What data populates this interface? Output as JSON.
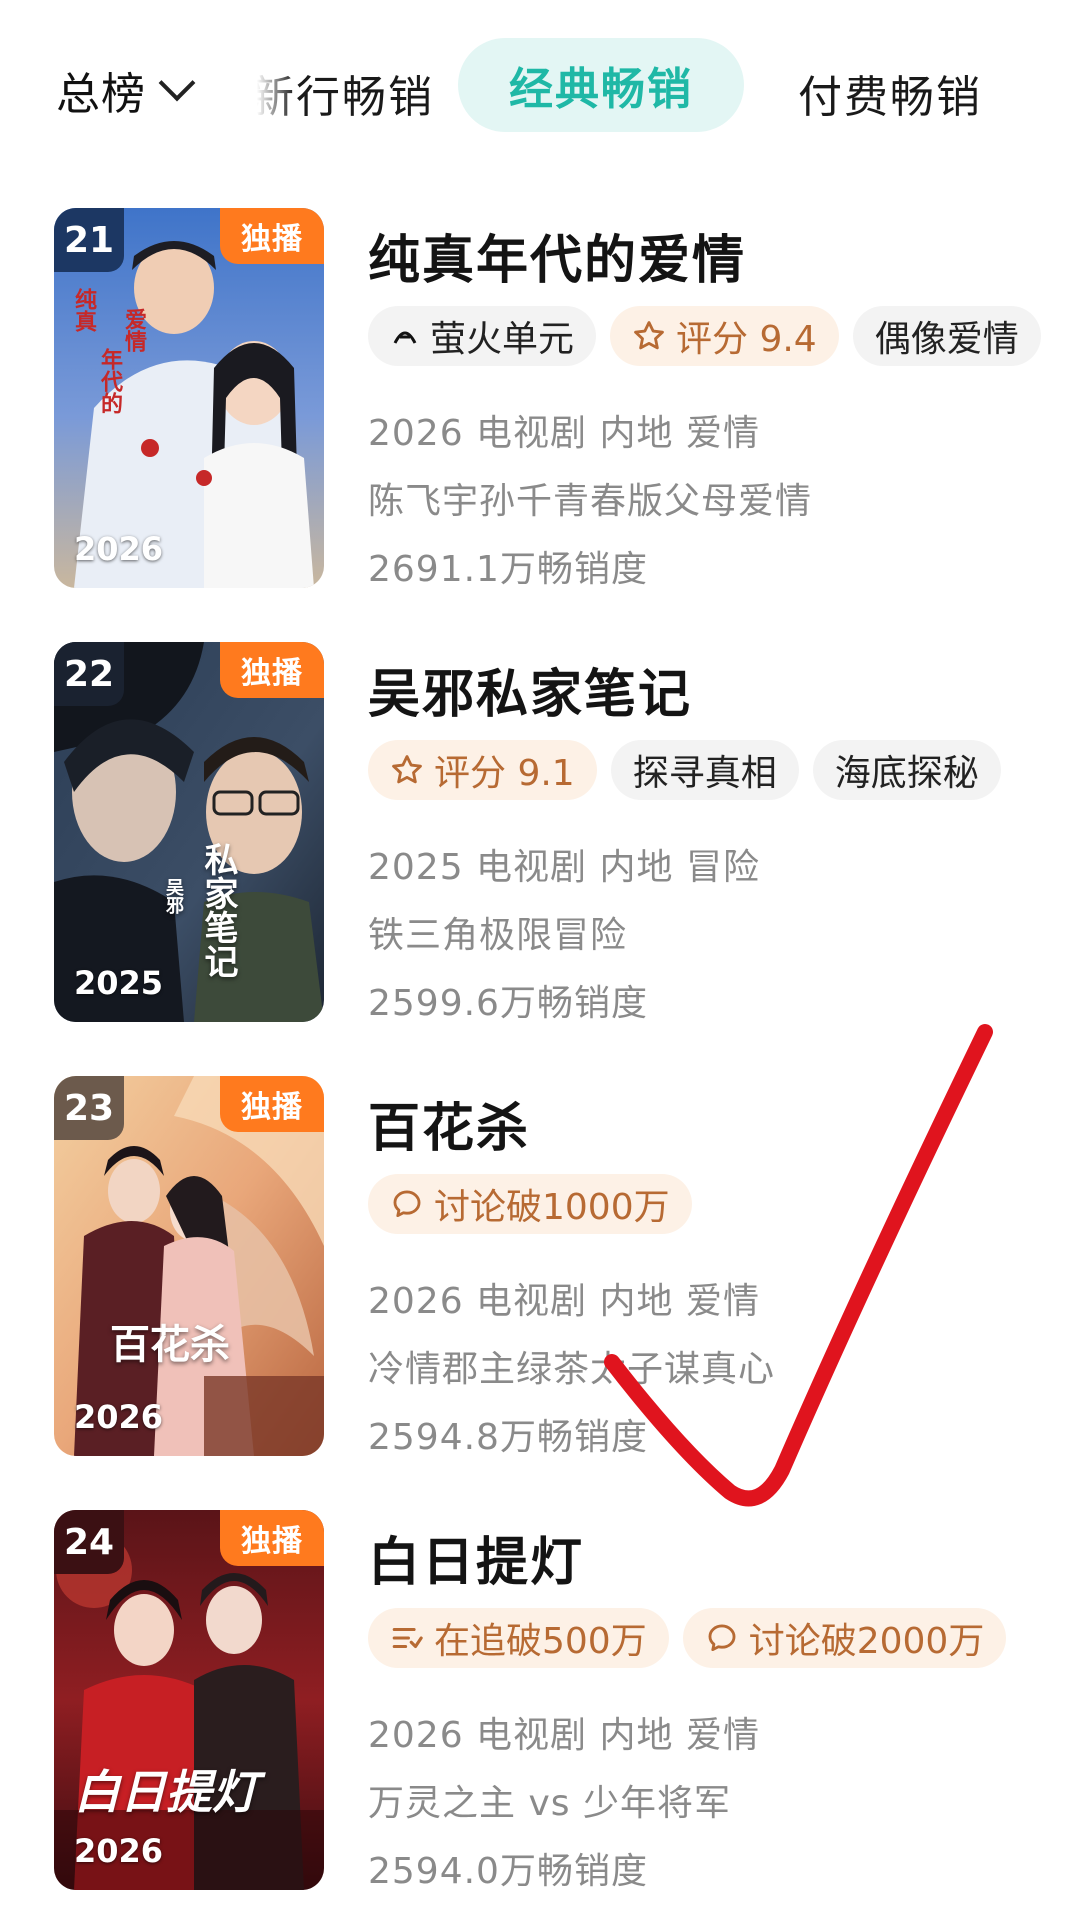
{
  "tabs": {
    "total": "总榜",
    "new": "新行畅销",
    "classic": "经典畅销",
    "paid": "付费畅销"
  },
  "badge_exclusive": "独播",
  "items": [
    {
      "rank": "21",
      "year": "2026",
      "title": "纯真年代的爱情",
      "tags": [
        {
          "text": "萤火单元",
          "icon": "firefly-logo-icon"
        },
        {
          "text": "评分 9.4",
          "icon": "star-icon"
        },
        {
          "text": "偶像爱情",
          "icon": ""
        }
      ],
      "meta": "2026 电视剧 内地 爱情",
      "desc": "陈飞宇孙千青春版父母爱情",
      "sales": "2691.1万畅销度"
    },
    {
      "rank": "22",
      "year": "2025",
      "title": "吴邪私家笔记",
      "tags": [
        {
          "text": "评分 9.1",
          "icon": "star-icon"
        },
        {
          "text": "探寻真相",
          "icon": ""
        },
        {
          "text": "海底探秘",
          "icon": ""
        }
      ],
      "meta": "2025 电视剧 内地 冒险",
      "desc": "铁三角极限冒险",
      "sales": "2599.6万畅销度"
    },
    {
      "rank": "23",
      "year": "2026",
      "title": "百花杀",
      "tags": [
        {
          "text": "讨论破1000万",
          "icon": "chat-bubble-icon"
        }
      ],
      "meta": "2026 电视剧 内地 爱情",
      "desc": "冷情郡主绿茶太子谋真心",
      "sales": "2594.8万畅销度"
    },
    {
      "rank": "24",
      "year": "2026",
      "title": "白日提灯",
      "tags": [
        {
          "text": "在追破500万",
          "icon": "list-follow-icon"
        },
        {
          "text": "讨论破2000万",
          "icon": "chat-bubble-icon"
        }
      ],
      "meta": "2026 电视剧 内地 爱情",
      "desc": "万灵之主 vs 少年将军",
      "sales": "2594.0万畅销度"
    }
  ],
  "poster_art": {
    "p1": {
      "line1": "纯真",
      "line2": "年代的",
      "line3": "爱情"
    },
    "p2": {
      "line1": "私家笔记",
      "line2": "吴邪"
    },
    "p3": {
      "line1": "百花杀"
    },
    "p4": {
      "line1": "白日提灯"
    }
  },
  "colors": {
    "accent": "#1fb8a6",
    "accent_bg": "#e3f6f4",
    "exclusive": "#ff7a1e",
    "hot_tag_bg": "#fdf1e6",
    "hot_tag_text": "#b76a33",
    "meta_text": "#8a8a8a",
    "annotation": "#e0141e"
  }
}
